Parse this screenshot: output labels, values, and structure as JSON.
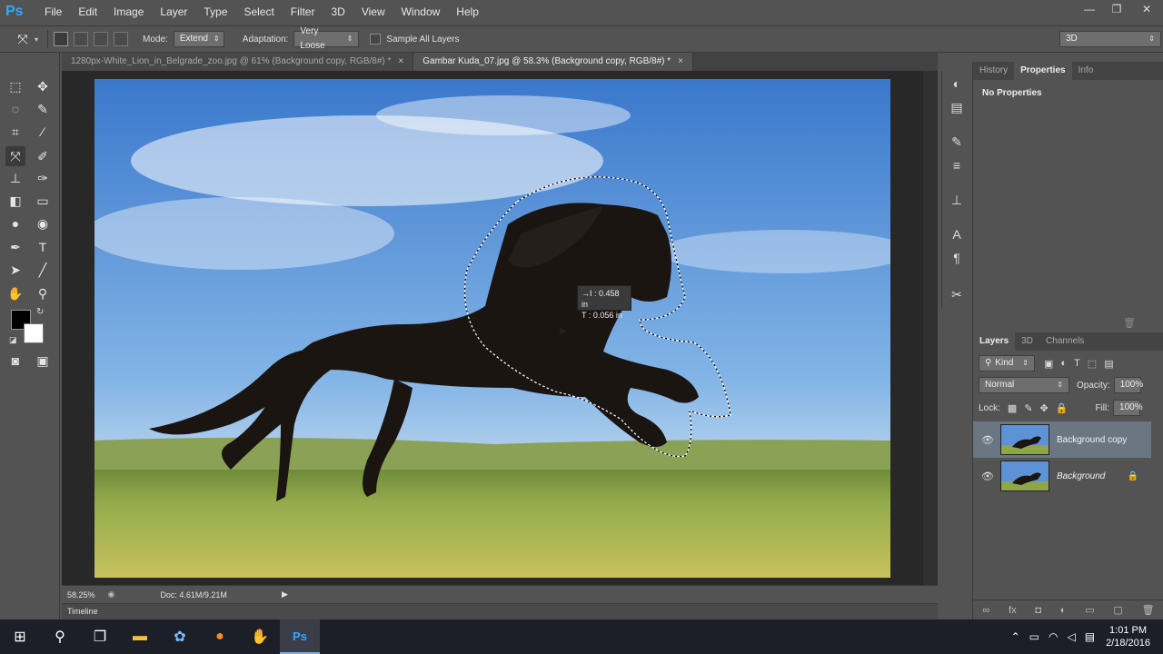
{
  "app": {
    "logo": "Ps"
  },
  "menu": [
    "File",
    "Edit",
    "Image",
    "Layer",
    "Type",
    "Select",
    "Filter",
    "3D",
    "View",
    "Window",
    "Help"
  ],
  "window_controls": {
    "minimize": "—",
    "restore": "❐",
    "close": "✕"
  },
  "options": {
    "mode_label": "Mode:",
    "mode_value": "Extend",
    "adaptation_label": "Adaptation:",
    "adaptation_value": "Very Loose",
    "sample_all_layers": "Sample All Layers",
    "sample_all_checked": false,
    "workspace_value": "3D"
  },
  "tabs": [
    {
      "label": "1280px-White_Lion_in_Belgrade_zoo.jpg @ 61% (Background copy, RGB/8#) *",
      "close": "×",
      "active": false
    },
    {
      "label": "Gambar Kuda_07.jpg @ 58.3% (Background copy, RGB/8#) *",
      "close": "×",
      "active": true
    }
  ],
  "measure_tip": {
    "line1": "→I :  0.458 in",
    "line2": "T :  0.056 in"
  },
  "status": {
    "zoom": "58.25%",
    "doc": "Doc: 4.61M/9.21M"
  },
  "timeline_label": "Timeline",
  "properties_panel": {
    "tabs": [
      "History",
      "Properties",
      "Info"
    ],
    "active_tab": "Properties",
    "content": "No Properties"
  },
  "layers_panel": {
    "tabs": [
      "Layers",
      "3D",
      "Channels"
    ],
    "active_tab": "Layers",
    "filter_value": "Kind",
    "blend_mode": "Normal",
    "opacity_label": "Opacity:",
    "opacity_value": "100%",
    "lock_label": "Lock:",
    "fill_label": "Fill:",
    "fill_value": "100%",
    "layers": [
      {
        "name": "Background copy",
        "visible": true,
        "selected": true,
        "locked": false
      },
      {
        "name": "Background",
        "visible": true,
        "selected": false,
        "locked": true
      }
    ]
  },
  "taskbar": {
    "time": "1:01 PM",
    "date": "2/18/2016"
  },
  "colors": {
    "ui_bg": "#535353",
    "canvas_bg": "#282828",
    "sky_top": "#3f7ed0",
    "horse": "#1a1412",
    "grass": "#9bb24a",
    "ps_blue": "#31a8ff"
  }
}
